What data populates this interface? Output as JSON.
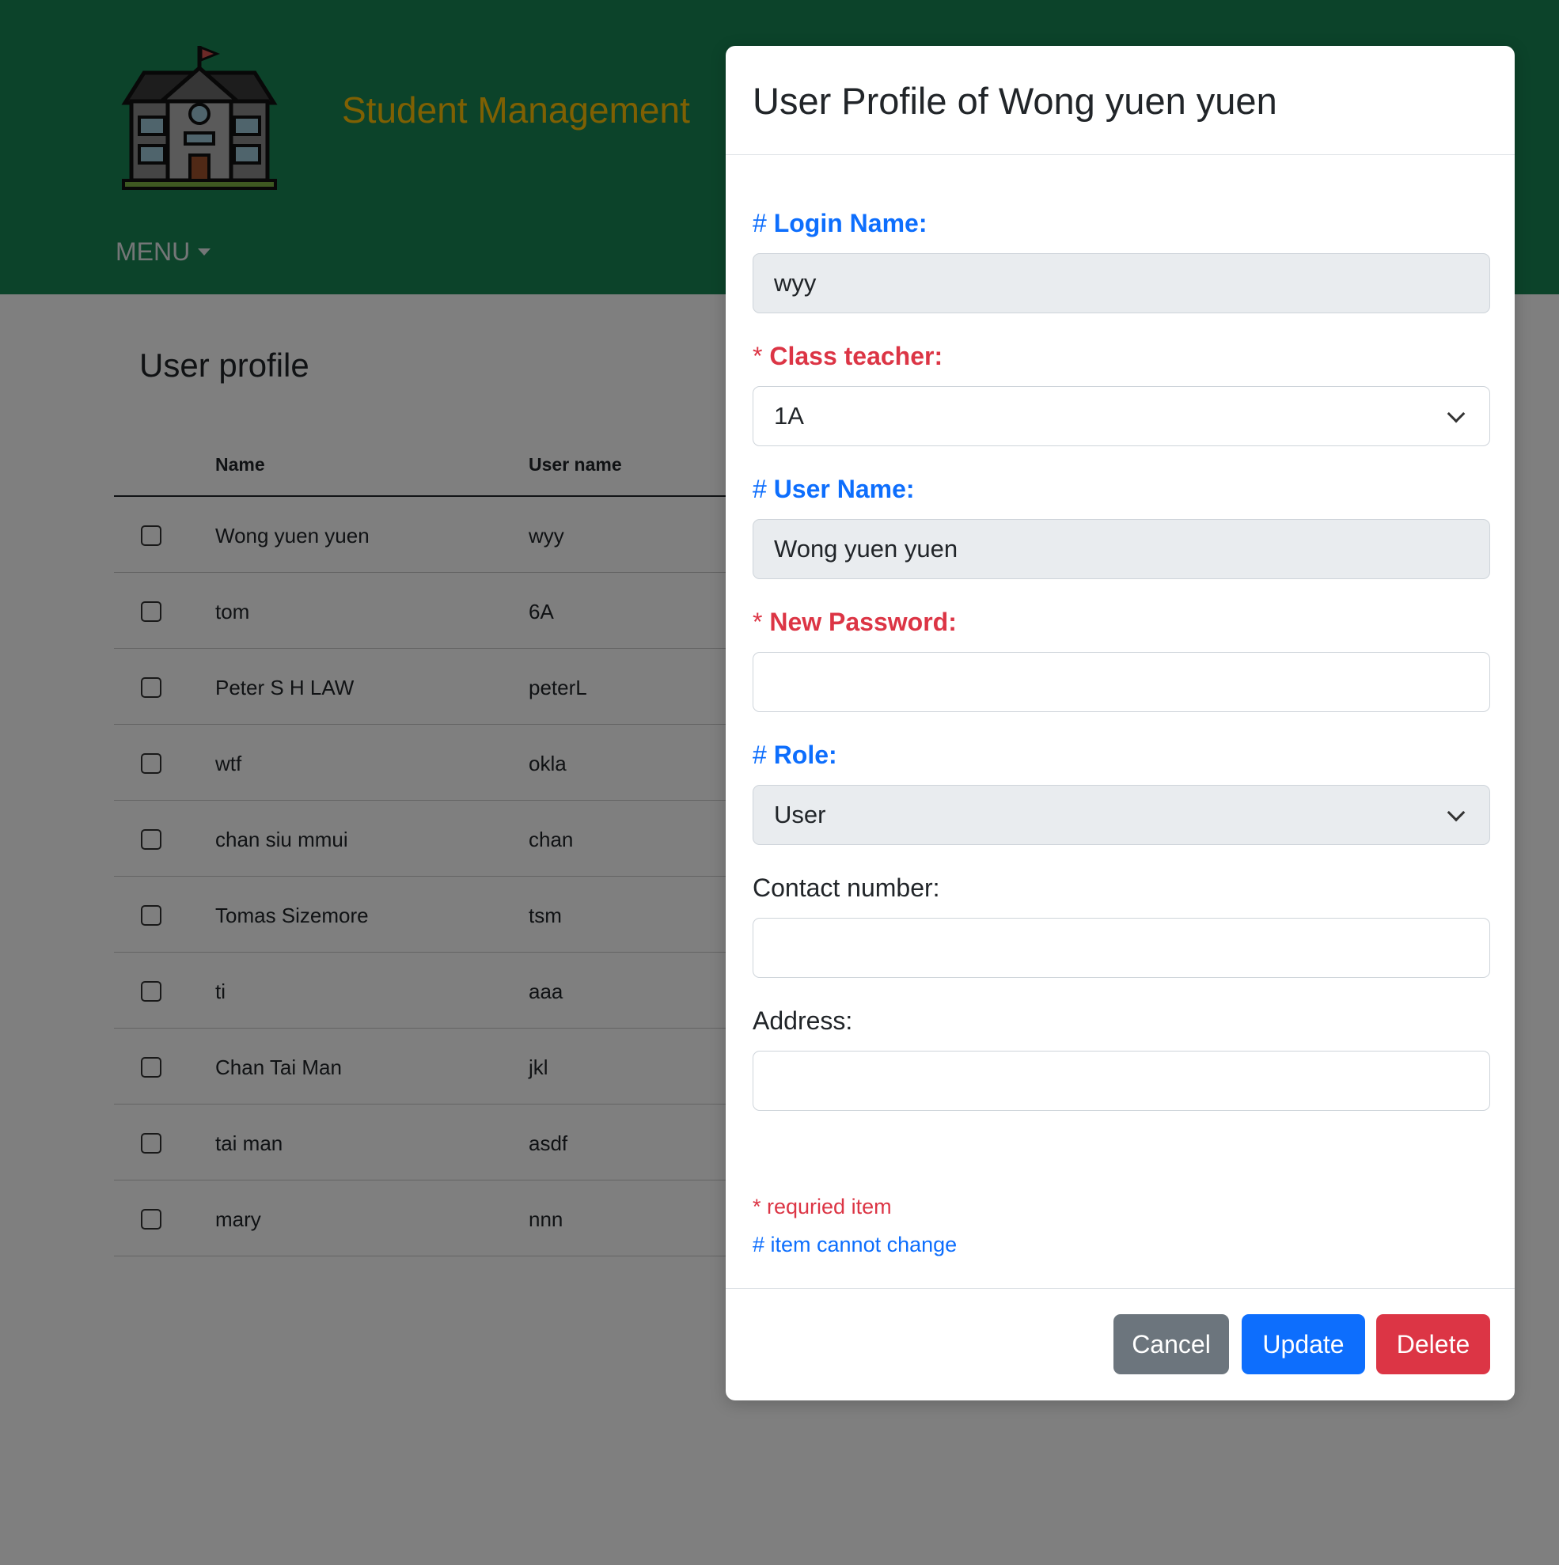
{
  "header": {
    "app_title": "Student Management",
    "menu_label": "MENU",
    "logo_icon": "school-building-icon"
  },
  "colors": {
    "header_bg": "#198754",
    "title_yellow": "#ffc107",
    "primary": "#0d6efd",
    "danger": "#dc3545",
    "secondary": "#6c757d"
  },
  "page": {
    "section_title": "User profile",
    "columns": [
      "Name",
      "User name"
    ],
    "rows": [
      {
        "name": "Wong yuen yuen",
        "username": "wyy"
      },
      {
        "name": "tom",
        "username": "6A"
      },
      {
        "name": "Peter S H LAW",
        "username": "peterL"
      },
      {
        "name": "wtf",
        "username": "okla"
      },
      {
        "name": "chan siu mmui",
        "username": "chan"
      },
      {
        "name": "Tomas Sizemore",
        "username": "tsm"
      },
      {
        "name": "ti",
        "username": "aaa"
      },
      {
        "name": "Chan Tai Man",
        "username": "jkl"
      },
      {
        "name": "tai man",
        "username": "asdf"
      },
      {
        "name": "mary",
        "username": "nnn"
      }
    ]
  },
  "modal": {
    "title": "User Profile of Wong yuen yuen",
    "fields": {
      "login_name": {
        "marker": "#",
        "label": "Login Name:",
        "value": "wyy"
      },
      "class_teacher": {
        "marker": "*",
        "label": "Class teacher:",
        "value": "1A"
      },
      "user_name": {
        "marker": "#",
        "label": "User Name:",
        "value": "Wong yuen yuen"
      },
      "new_password": {
        "marker": "*",
        "label": "New Password:",
        "value": ""
      },
      "role": {
        "marker": "#",
        "label": "Role:",
        "value": "User"
      },
      "contact_number": {
        "label": "Contact number:",
        "value": ""
      },
      "address": {
        "label": "Address:",
        "value": ""
      }
    },
    "notes": {
      "required": "* requried item",
      "cannot_change": "# item cannot change"
    },
    "buttons": {
      "cancel": "Cancel",
      "update": "Update",
      "delete": "Delete"
    }
  }
}
